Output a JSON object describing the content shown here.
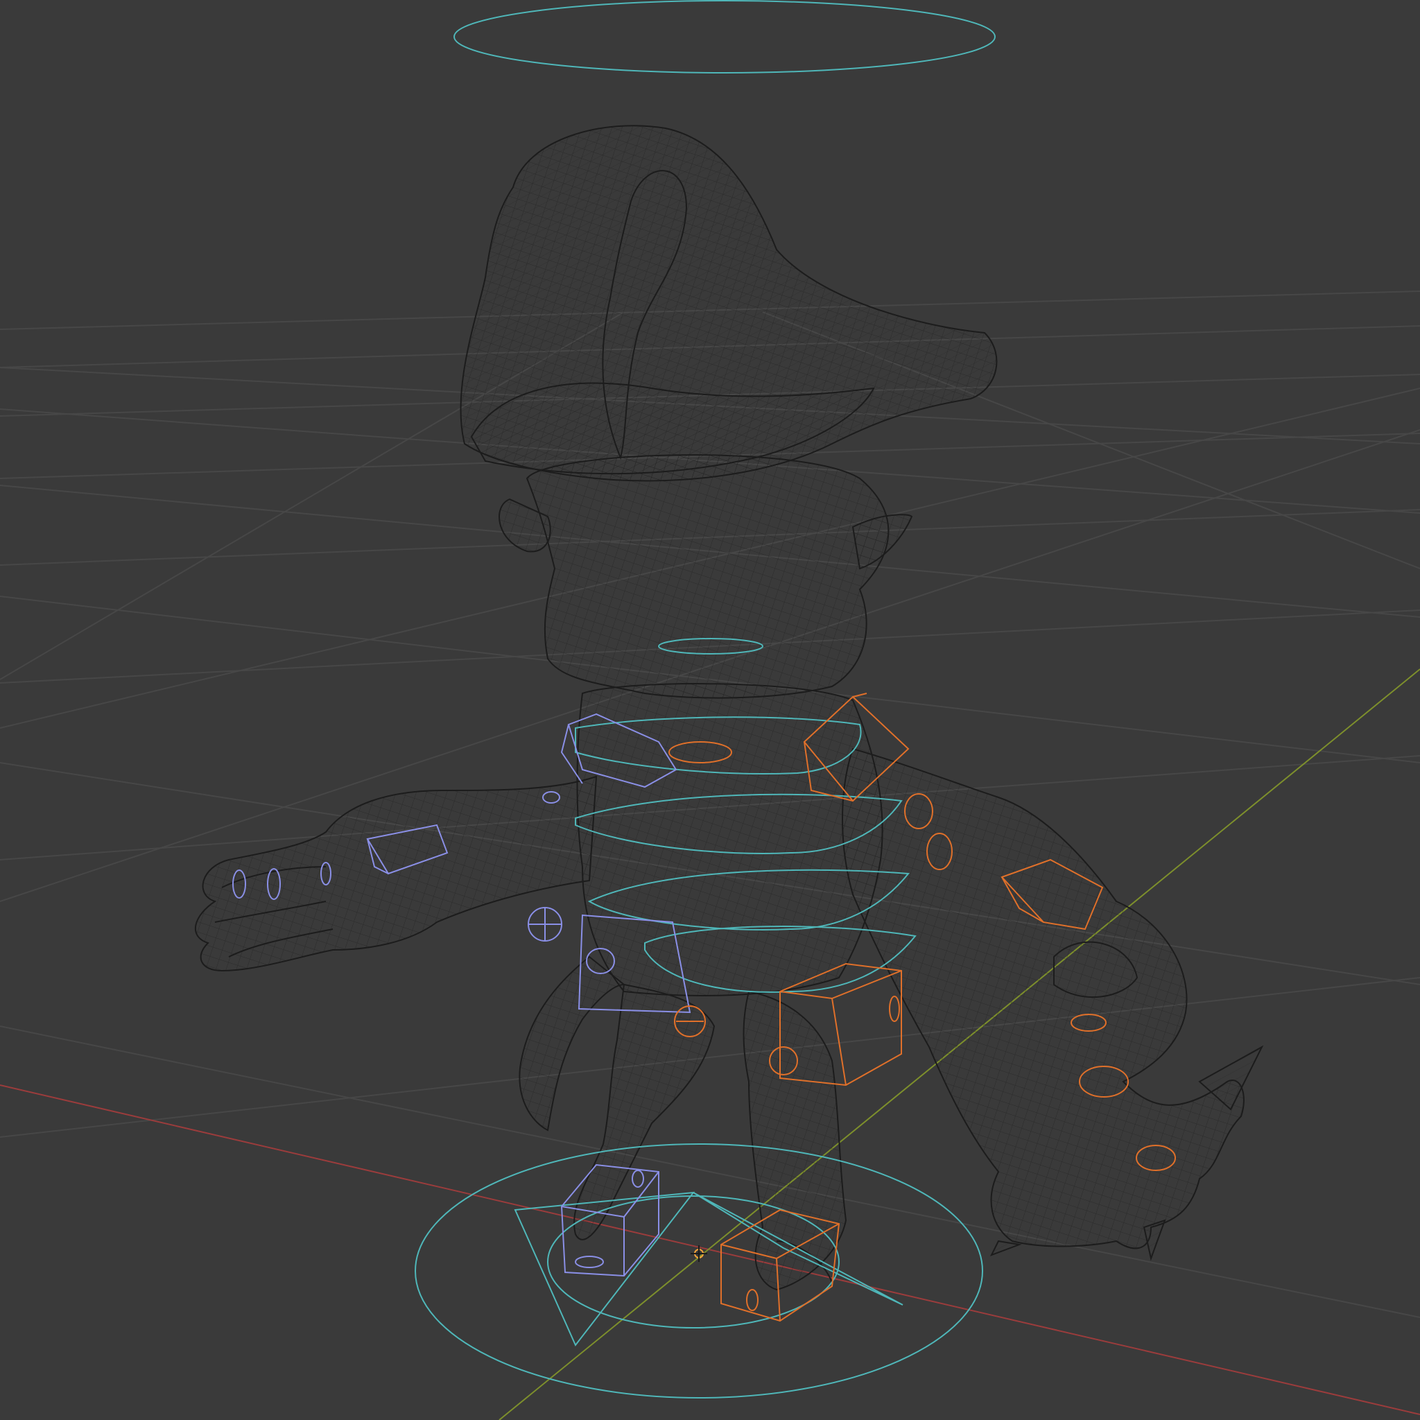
{
  "app": {
    "view": "3d-viewport",
    "shading_mode": "wireframe"
  },
  "colors": {
    "background": "#3a3a3a",
    "grid": "#4a4a4a",
    "x_axis": "#9b3c3c",
    "y_axis": "#7d8f2c",
    "mesh_wire": "#1c1c1c",
    "control_cyan": "#4fb7b9",
    "control_left": "#8a8fe6",
    "control_right": "#e0702a",
    "origin_marker": "#f2a23a"
  },
  "objects": [
    {
      "name": "character-mesh",
      "icon": "wireframe-mesh-icon"
    },
    {
      "name": "rig-root-control",
      "icon": "circle-control-icon"
    },
    {
      "name": "rig-head-control",
      "icon": "circle-control-icon"
    },
    {
      "name": "rig-torso-controls",
      "icon": "plane-control-icon"
    },
    {
      "name": "rig-left-controls",
      "icon": "cube-control-icon"
    },
    {
      "name": "rig-right-controls",
      "icon": "cube-control-icon"
    },
    {
      "name": "scene-origin",
      "icon": "origin-icon"
    }
  ]
}
